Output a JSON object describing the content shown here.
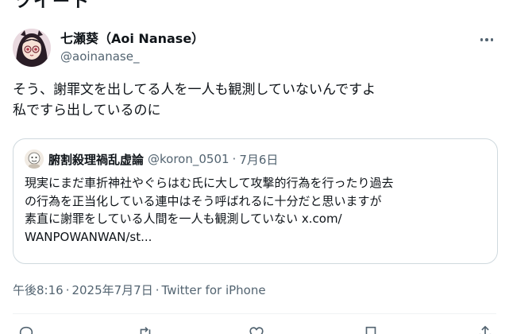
{
  "header_fragment": "ツイート",
  "author": {
    "display_name": "七瀬葵（Aoi Nanase）",
    "handle": "@aoinanase_"
  },
  "tweet": {
    "lines": [
      "そう、謝罪文を出してる人を一人も観測していないんですよ",
      "私ですら出しているのに"
    ]
  },
  "quote": {
    "display_name": "腑割殺理禍乱虚論",
    "handle": "@koron_0501",
    "separator": "·",
    "date": "7月6日",
    "lines": [
      "現実にまだ車折神社やぐらはむ氏に大して攻撃的行為を行ったり過去",
      "の行為を正当化している連中はそう呼ばれるに十分だと思いますが",
      "素直に謝罪をしている人間を一人も観測していない x.com/",
      "WANPOWANWAN/st..."
    ]
  },
  "meta": {
    "time": "午後8:16",
    "separator": "·",
    "date": "2025年7月7日",
    "source": "Twitter for iPhone"
  },
  "icons": {
    "more": "more-horizontal-icon",
    "reply": "reply-icon",
    "retweet": "retweet-icon",
    "like": "heart-icon",
    "bookmark": "bookmark-icon",
    "share": "share-icon"
  },
  "colors": {
    "text": "#0f1419",
    "secondary": "#536471",
    "border": "#cfd9de"
  }
}
